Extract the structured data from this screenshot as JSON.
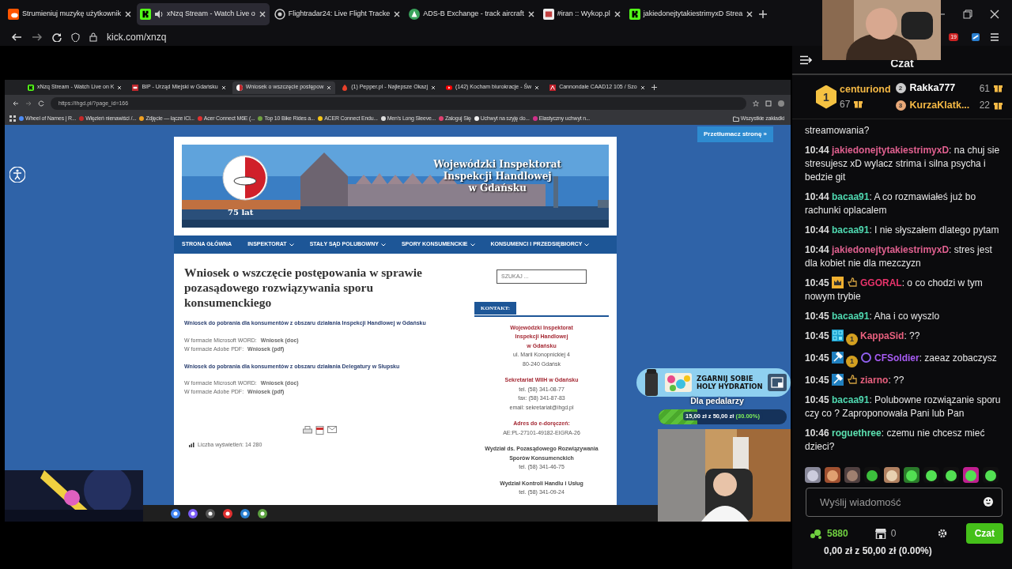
{
  "outer_browser": {
    "tabs": [
      {
        "title": "Strumieniuj muzykę użytkownik",
        "kind": "soundcloud",
        "selected": false,
        "audio": false
      },
      {
        "title": "xNzq Stream - Watch Live o",
        "kind": "kick",
        "selected": true,
        "audio": true
      },
      {
        "title": "Flightradar24: Live Flight Tracke",
        "kind": "radar",
        "selected": false,
        "audio": false
      },
      {
        "title": "ADS-B Exchange - track aircraft",
        "kind": "adsb",
        "selected": false,
        "audio": false
      },
      {
        "title": "#iran :: Wykop.pl",
        "kind": "wykop",
        "selected": false,
        "audio": false
      },
      {
        "title": "jakiedonejtytakiestrimyxD Strea",
        "kind": "kick",
        "selected": false,
        "audio": false
      }
    ],
    "address": "kick.com/xnzq",
    "extension_badge": "19"
  },
  "stream": {
    "browser": {
      "tabs": [
        {
          "title": "xNzq Stream - Watch Live on K",
          "kind": "kick",
          "selected": false
        },
        {
          "title": "BIP - Urząd Miejski w Gdańsku",
          "kind": "bip",
          "selected": false
        },
        {
          "title": "Wniosek o wszczęcie postępow",
          "kind": "ihgd",
          "selected": true
        },
        {
          "title": "(1) Pepper.pl - Najlepsze Okazj",
          "kind": "pepper",
          "selected": false
        },
        {
          "title": "(142) Kocham biurokracje - Św",
          "kind": "youtube",
          "selected": false
        },
        {
          "title": "Cannondale CAAD12 105 / Szo",
          "kind": "bike",
          "selected": false
        }
      ],
      "address": "https://ihgd.pl/?page_id=166",
      "bookmarks": [
        {
          "title": "Wheel of Names | R...",
          "color": "#4c8bf5"
        },
        {
          "title": "Więzień nienawiści /...",
          "color": "#c62828"
        },
        {
          "title": "Zdjęcie — łącze iCl...",
          "color": "#f0a020"
        },
        {
          "title": "Acer Connect M6E (...",
          "color": "#e03030"
        },
        {
          "title": "Top 10 Bike Rides a...",
          "color": "#70a040"
        },
        {
          "title": "ACER Connect Endu...",
          "color": "#f5c518"
        },
        {
          "title": "Men's Long Sleeve...",
          "color": "#dddddd"
        },
        {
          "title": "Zaloguj Się",
          "color": "#e04070"
        },
        {
          "title": "Uchwyt na szyję do...",
          "color": "#f0f0f0"
        },
        {
          "title": "Elastyczny uchwyt n...",
          "color": "#d0308a"
        }
      ],
      "all_bookmarks": "Wszystkie zakładki"
    },
    "page": {
      "translate_button": "Przetłumacz stronę »",
      "banner": {
        "title_lines": [
          "Wojewódzki Inspektorat",
          "Inspekcji Handlowej",
          "w Gdańsku"
        ],
        "anniversary": "75 lat"
      },
      "nav": [
        {
          "label": "STRONA GŁÓWNA",
          "dropdown": false
        },
        {
          "label": "INSPEKTORAT",
          "dropdown": true
        },
        {
          "label": "STAŁY SĄD POLUBOWNY",
          "dropdown": true
        },
        {
          "label": "SPORY KONSUMENCKIE",
          "dropdown": true
        },
        {
          "label": "KONSUMENCI I PRZEDSIĘBIORCY",
          "dropdown": true
        }
      ],
      "title": "Wniosek o wszczęcie postępowania w sprawie pozasądowego rozwiązywania sporu konsumenckiego",
      "sections": [
        {
          "heading": "Wniosek do pobrania dla konsumentów z obszaru działania Inspekcji Handlowej w Gdańsku",
          "downloads": [
            {
              "format": "W formacie Microsoft WORD:",
              "link": "Wniosek (doc)"
            },
            {
              "format": "W formacie Adobe PDF:",
              "link": "Wniosek (pdf)"
            }
          ]
        },
        {
          "heading": "Wniosek do pobrania dla konsumentów z obszaru działania Delegatury w Słupsku",
          "downloads": [
            {
              "format": "W formacie Microsoft WORD:",
              "link": "Wniosek (doc)"
            },
            {
              "format": "W formacie Adobe PDF:",
              "link": "Wniosek (pdf)"
            }
          ]
        }
      ],
      "views": "Liczba wyświetleń: 14 280",
      "search": {
        "placeholder": "SZUKAJ ..."
      },
      "contact": {
        "heading": "KONTAKT:",
        "blocks": [
          {
            "kind": "office",
            "title_lines": [
              "Wojewódzki Inspektorat",
              "Inspekcji Handlowej",
              "w Gdańsku"
            ],
            "lines": [
              "ul. Marii Konopnickiej 4",
              "80-240 Gdańsk"
            ]
          },
          {
            "kind": "office",
            "title_lines": [
              "Sekretariat WIIH w Gdańsku"
            ],
            "lines": [
              "tel. (58) 341-08-77",
              "fax: (58) 341-87-83",
              "email: sekretariat@ihgd.pl"
            ]
          },
          {
            "kind": "office",
            "title_lines": [
              "Adres do e-doręczeń:"
            ],
            "lines": [
              "AE:PL-27101-49182-EIGRA-26"
            ]
          },
          {
            "kind": "department",
            "title_lines": [
              "Wydział ds. Pozasądowego Rozwiązywania",
              "Sporów Konsumenckich"
            ],
            "lines": [
              "tel. (58) 341-46-75"
            ]
          },
          {
            "kind": "department",
            "title_lines": [
              "Wydział Kontroli Handlu i Usług"
            ],
            "lines": [
              "tel. (58) 341-09-24"
            ]
          }
        ]
      }
    },
    "ad": {
      "text_lines": [
        "ZGARNIJ SOBIE",
        "HOLY HYDRATION"
      ]
    },
    "goal": {
      "title": "Dla pedalarzy",
      "amount": "15,00 zł z 50,00 zł",
      "percent": "(30.00%)",
      "level": 0.3
    }
  },
  "chat": {
    "title": "Czat",
    "leaderboard": [
      {
        "rank": "1",
        "name": "centuriond",
        "count": "67",
        "color": "#f5b945"
      },
      {
        "rank": "2",
        "name": "Rakka777",
        "count": "61",
        "color": "#ffffff"
      },
      {
        "rank": "3",
        "name": "KurzaKlatk...",
        "count": "22",
        "color": "#f5b945"
      }
    ],
    "messages": [
      {
        "kind": "continuation",
        "text": "streamowania?"
      },
      {
        "kind": "message",
        "time": "10:44",
        "user": "jakiedonejtytakiestrimyxD",
        "color": "#e0608f",
        "text": ": na chuj sie stresujesz xD wylacz strima i silna psycha i bedzie git"
      },
      {
        "kind": "message",
        "time": "10:44",
        "user": "bacaa91",
        "color": "#4fd8b0",
        "text": ": A co rozmawiałeś już bo rachunki oplacalem"
      },
      {
        "kind": "message",
        "time": "10:44",
        "user": "bacaa91",
        "color": "#4fd8b0",
        "text": ": I nie słyszałem dlatego pytam"
      },
      {
        "kind": "message",
        "time": "10:44",
        "user": "jakiedonejtytakiestrimyxD",
        "color": "#e0608f",
        "text": ": stres jest dla kobiet nie dla mezczyzn"
      },
      {
        "kind": "message",
        "time": "10:45",
        "badges": [
          {
            "kind": "crown"
          },
          {
            "kind": "hand"
          }
        ],
        "user": "GGORAL",
        "color": "#e8336b",
        "text": ": o co chodzi w tym nowym trybie"
      },
      {
        "kind": "message",
        "time": "10:45",
        "user": "bacaa91",
        "color": "#4fd8b0",
        "text": ": Aha i co wyszlo"
      },
      {
        "kind": "message",
        "time": "10:45",
        "badges": [
          {
            "kind": "og"
          },
          {
            "kind": "coin",
            "label": "1"
          }
        ],
        "user": "KappaSid",
        "color": "#e8607e",
        "text": ": ??"
      },
      {
        "kind": "message",
        "time": "10:45",
        "badges": [
          {
            "kind": "hammer"
          },
          {
            "kind": "coin",
            "label": "1"
          },
          {
            "kind": "gem"
          }
        ],
        "user": "CFSoldier",
        "color": "#a85cf5",
        "text": ": zaeaz zobaczysz"
      },
      {
        "kind": "message",
        "time": "10:45",
        "badges": [
          {
            "kind": "hammer"
          },
          {
            "kind": "hand"
          }
        ],
        "user": "ziarno",
        "color": "#e8607e",
        "text": ": ??"
      },
      {
        "kind": "message",
        "time": "10:45",
        "user": "bacaa91",
        "color": "#4fd8b0",
        "text": ": Polubowne rozwiązanie sporu czy co ? Zaproponowała Pani lub Pan"
      },
      {
        "kind": "message",
        "time": "10:46",
        "user": "roguethree",
        "color": "#5ce0b0",
        "text": ": czemu nie chcesz mieć dzieci?"
      }
    ],
    "input": {
      "placeholder": "Wyślij wiadomość"
    },
    "points": "5880",
    "store_count": "0",
    "send_button": "Czat",
    "goal": "0,00 zł z 50,00 zł (0.00%)"
  }
}
